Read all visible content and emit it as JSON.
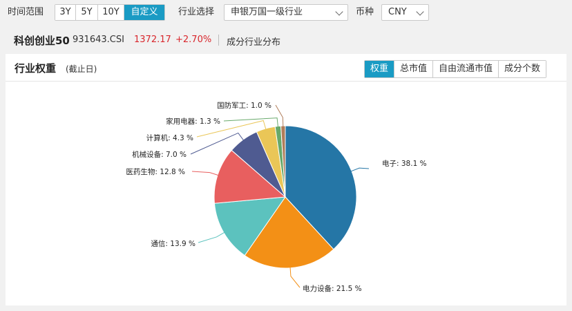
{
  "filters": {
    "time_label": "时间范围",
    "time_options": [
      "3Y",
      "5Y",
      "10Y",
      "自定义"
    ],
    "time_active": 3,
    "industry_label": "行业选择",
    "industry_value": "申银万国一级行业",
    "currency_label": "币种",
    "currency_value": "CNY"
  },
  "index": {
    "name": "科创创业50",
    "code": "931643.CSI",
    "price": "1372.17",
    "change": "+2.70%",
    "link": "成分行业分布"
  },
  "panel": {
    "title": "行业权重",
    "subtitle": "(截止日)",
    "tabs": [
      "权重",
      "总市值",
      "自由流通市值",
      "成分个数"
    ],
    "tab_active": 0
  },
  "chart_data": {
    "type": "pie",
    "slices": [
      {
        "name": "电子",
        "value": 38.1,
        "color": "#2576a6",
        "label": "电子: 38.1 %"
      },
      {
        "name": "电力设备",
        "value": 21.5,
        "color": "#f39016",
        "label": "电力设备: 21.5 %"
      },
      {
        "name": "通信",
        "value": 13.9,
        "color": "#5cc2be",
        "label": "通信: 13.9 %"
      },
      {
        "name": "医药生物",
        "value": 12.8,
        "color": "#e85f5f",
        "label": "医药生物: 12.8 %"
      },
      {
        "name": "机械设备",
        "value": 7.0,
        "color": "#4f5b91",
        "label": "机械设备: 7.0 %"
      },
      {
        "name": "计算机",
        "value": 4.3,
        "color": "#eac657",
        "label": "计算机: 4.3 %"
      },
      {
        "name": "家用电器",
        "value": 1.3,
        "color": "#67a96a",
        "label": "家用电器: 1.3 %"
      },
      {
        "name": "国防军工",
        "value": 1.0,
        "color": "#b07d5a",
        "label": "国防军工: 1.0 %"
      }
    ]
  }
}
